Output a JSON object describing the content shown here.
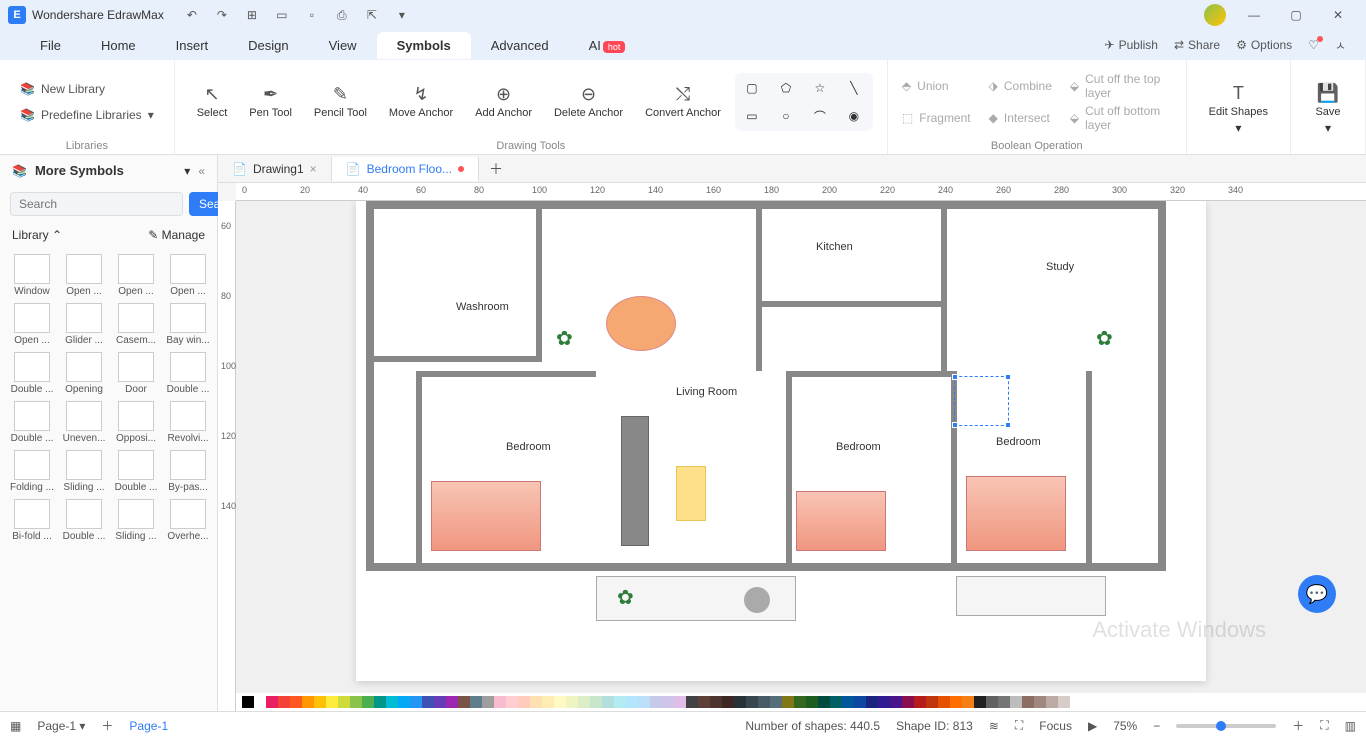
{
  "app": {
    "title": "Wondershare EdrawMax"
  },
  "menubar": {
    "items": [
      "File",
      "Home",
      "Insert",
      "Design",
      "View",
      "Symbols",
      "Advanced",
      "AI"
    ],
    "active": 5,
    "ai_badge": "hot",
    "right": {
      "publish": "Publish",
      "share": "Share",
      "options": "Options"
    }
  },
  "ribbon": {
    "libraries": {
      "new_lib": "New Library",
      "predef": "Predefine Libraries",
      "group_label": "Libraries"
    },
    "drawing": {
      "select": "Select",
      "pen": "Pen\nTool",
      "pencil": "Pencil\nTool",
      "move_anchor": "Move\nAnchor",
      "add_anchor": "Add\nAnchor",
      "delete_anchor": "Delete\nAnchor",
      "convert_anchor": "Convert\nAnchor",
      "group_label": "Drawing Tools"
    },
    "boolean": {
      "union": "Union",
      "combine": "Combine",
      "cut_top": "Cut off the top layer",
      "fragment": "Fragment",
      "intersect": "Intersect",
      "cut_bottom": "Cut off bottom layer",
      "group_label": "Boolean Operation"
    },
    "edit_shapes": "Edit\nShapes",
    "save": "Save"
  },
  "sidebar": {
    "title": "More Symbols",
    "search_ph": "Search",
    "search_btn": "Search",
    "lib_label": "Library",
    "manage": "Manage",
    "shapes": [
      "Window",
      "Open ...",
      "Open ...",
      "Open ...",
      "Open ...",
      "Glider ...",
      "Casem...",
      "Bay win...",
      "Double ...",
      "Opening",
      "Door",
      "Double ...",
      "Double ...",
      "Uneven...",
      "Opposi...",
      "Revolvi...",
      "Folding ...",
      "Sliding ...",
      "Double ...",
      "By-pas...",
      "Bi-fold ...",
      "Double ...",
      "Sliding ...",
      "Overhe..."
    ]
  },
  "tabs": {
    "t1": "Drawing1",
    "t2": "Bedroom Floo...",
    "active": 1
  },
  "ruler_h": [
    0,
    20,
    40,
    60,
    80,
    100,
    120,
    140,
    160,
    180,
    200,
    220,
    240,
    260,
    280,
    300,
    320,
    340
  ],
  "ruler_v": [
    60,
    80,
    100,
    120,
    140
  ],
  "rooms": {
    "kitchen": "Kitchen",
    "study": "Study",
    "washroom": "Washroom",
    "living": "Living Room",
    "bed1": "Bedroom",
    "bed2": "Bedroom",
    "bed3": "Bedroom"
  },
  "colorbar": [
    "#000",
    "#fff",
    "#e91e63",
    "#f44336",
    "#ff5722",
    "#ff9800",
    "#ffc107",
    "#ffeb3b",
    "#cddc39",
    "#8bc34a",
    "#4caf50",
    "#009688",
    "#00bcd4",
    "#03a9f4",
    "#2196f3",
    "#3f51b5",
    "#673ab7",
    "#9c27b0",
    "#795548",
    "#607d8b",
    "#9e9e9e",
    "#f8bbd0",
    "#ffcdd2",
    "#ffccbc",
    "#ffe0b2",
    "#ffecb3",
    "#fff9c4",
    "#f0f4c3",
    "#dcedc8",
    "#c8e6c9",
    "#b2dfdb",
    "#b2ebf2",
    "#b3e5fc",
    "#bbdefb",
    "#c5cae9",
    "#d1c4e9",
    "#e1bee7",
    "#424242",
    "#5d4037",
    "#4e342e",
    "#3e2723",
    "#263238",
    "#37474f",
    "#455a64",
    "#546e7a",
    "#827717",
    "#33691e",
    "#1b5e20",
    "#004d40",
    "#006064",
    "#01579b",
    "#0d47a1",
    "#1a237e",
    "#311b92",
    "#4a148c",
    "#880e4f",
    "#b71c1c",
    "#bf360c",
    "#e65100",
    "#ff6f00",
    "#f57f17",
    "#212121",
    "#616161",
    "#757575",
    "#bdbdbd",
    "#8d6e63",
    "#a1887f",
    "#bcaaa4",
    "#d7ccc8"
  ],
  "status": {
    "page": "Page-1",
    "page2": "Page-1",
    "num_shapes": "Number of shapes: 440.5",
    "shape_id": "Shape ID: 813",
    "focus": "Focus",
    "zoom": "75%"
  },
  "watermark": "Activate Windows"
}
